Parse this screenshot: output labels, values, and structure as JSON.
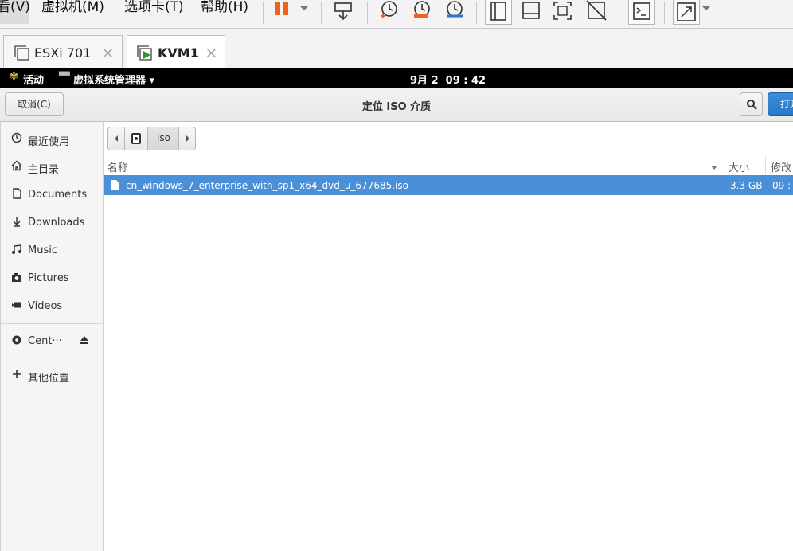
{
  "vmware": {
    "menus": [
      "看(V)",
      "虚拟机(M)",
      "选项卡(T)",
      "帮助(H)"
    ],
    "tabs": [
      {
        "label": "ESXi 701",
        "active": false
      },
      {
        "label": "KVM1",
        "active": true
      }
    ]
  },
  "gnome_bar": {
    "activities": "活动",
    "app_menu": "虚拟系统管理器 ▾",
    "clock": "9月 2  09 : 42"
  },
  "dialog": {
    "title": "定位 ISO 介质",
    "cancel_label": "取消(C)",
    "open_label": "打开",
    "search_icon": "search-icon"
  },
  "sidebar": {
    "items": [
      {
        "label": "最近使用",
        "icon": "clock-icon"
      },
      {
        "label": "主目录",
        "icon": "home-icon"
      },
      {
        "label": "Documents",
        "icon": "document-icon"
      },
      {
        "label": "Downloads",
        "icon": "download-icon"
      },
      {
        "label": "Music",
        "icon": "music-icon"
      },
      {
        "label": "Pictures",
        "icon": "camera-icon"
      },
      {
        "label": "Videos",
        "icon": "video-icon"
      },
      {
        "label": "Cent···",
        "icon": "disc-icon"
      },
      {
        "label": "其他位置",
        "icon": "plus-icon"
      }
    ]
  },
  "pathbar": {
    "current": "iso"
  },
  "columns": {
    "name": "名称",
    "size": "大小",
    "modified": "修改"
  },
  "files": [
    {
      "name": "cn_windows_7_enterprise_with_sp1_x64_dvd_u_677685.iso",
      "size": "3.3 GB",
      "modified": "09 :",
      "selected": true
    }
  ],
  "colors": {
    "selection": "#4a90d9",
    "suggested_button": "#2a76c6",
    "pause_orange": "#f0631c"
  }
}
